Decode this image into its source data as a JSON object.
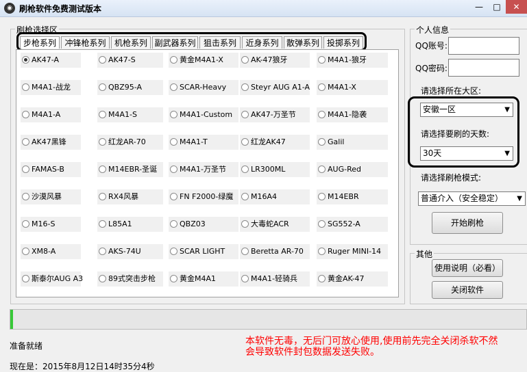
{
  "window": {
    "title": "刷枪软件免费测试版本",
    "icon_name": "app-logo-icon",
    "min_label": "—",
    "max_label": "□",
    "close_label": "✕"
  },
  "weapon_section": {
    "label": "刷枪选择区",
    "tabs": [
      {
        "label": "步枪系列",
        "active": true
      },
      {
        "label": "冲锋枪系列"
      },
      {
        "label": "机枪系列"
      },
      {
        "label": "副武器系列"
      },
      {
        "label": "狙击系列"
      },
      {
        "label": "近身系列"
      },
      {
        "label": "散弹系列"
      },
      {
        "label": "投掷系列"
      }
    ],
    "rows": [
      [
        "AK47-A",
        "AK47-S",
        "黄金M4A1-X",
        "AK-47狼牙",
        "M4A1-狼牙"
      ],
      [
        "M4A1-战龙",
        "QBZ95-A",
        "SCAR-Heavy",
        "Steyr AUG A1-A",
        "M4A1-X"
      ],
      [
        "M4A1-A",
        "M4A1-S",
        "M4A1-Custom",
        "AK47-万圣节",
        "M4A1-隐袭"
      ],
      [
        "AK47黑锋",
        "红龙AR-70",
        "M4A1-T",
        "红龙AK47",
        "Galil"
      ],
      [
        "FAMAS-B",
        "M14EBR-圣诞",
        "M4A1-万圣节",
        "LR300ML",
        "AUG-Red"
      ],
      [
        "沙漠风暴",
        "RX4风暴",
        "FN F2000-绿魔",
        "M16A4",
        "M14EBR"
      ],
      [
        "M16-S",
        "L85A1",
        "QBZ03",
        "大毒蛇ACR",
        "SG552-A"
      ],
      [
        "XM8-A",
        "AKS-74U",
        "SCAR LIGHT",
        "Beretta AR-70",
        "Ruger MINI-14"
      ],
      [
        "斯泰尔AUG A3",
        "89式突击步枪",
        "黄金M4A1",
        "M4A1-轻骑兵",
        "黄金AK-47"
      ]
    ],
    "selected": "AK47-A"
  },
  "personal": {
    "label": "个人信息",
    "qq_account_label": "QQ账号:",
    "qq_account_value": "",
    "qq_password_label": "QQ密码:",
    "qq_password_value": "",
    "region_label": "请选择所在大区:",
    "region_value": "安徽一区",
    "days_label": "请选择要刷的天数:",
    "days_value": "30天",
    "mode_label": "请选择刷枪模式:",
    "mode_value": "普通介入（安全稳定）",
    "start_button": "开始刷枪"
  },
  "other": {
    "label": "其他",
    "help_button": "使用说明（必看）",
    "close_button": "关闭软件"
  },
  "progress": {
    "value": 0.005,
    "color": "#37c837"
  },
  "status": {
    "text": "准备就绪",
    "clock": "现在是：2015年8月12日14时35分4秒"
  },
  "notice": {
    "text": "本软件无毒，无后门可放心使用,使用前先完全关闭杀软不然会导致软件封包数据发送失败。",
    "color": "#ff0000"
  }
}
